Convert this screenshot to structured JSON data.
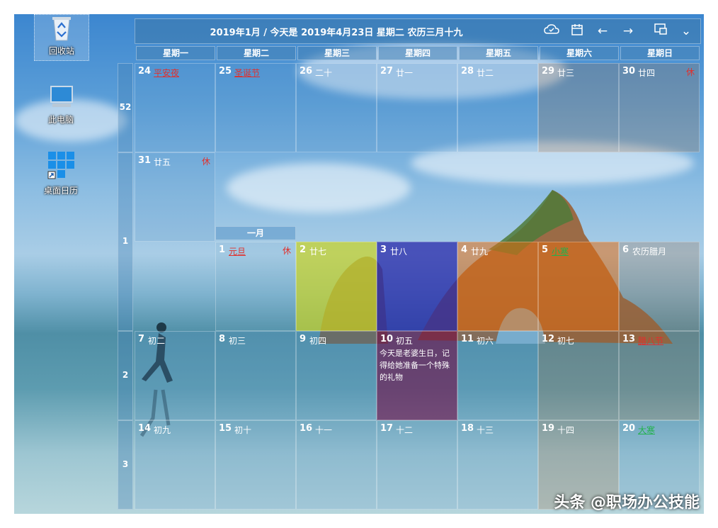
{
  "desktop_icons": [
    {
      "label": "回收站",
      "icon": "recycle-bin-icon"
    },
    {
      "label": "此电脑",
      "icon": "computer-icon"
    },
    {
      "label": "桌面日历",
      "icon": "desktop-calendar-shortcut-icon"
    }
  ],
  "header": {
    "title": "2019年1月 / 今天是 2019年4月23日 星期二 农历三月十九",
    "buttons": [
      "cloud-sync-icon",
      "calendar-icon",
      "arrow-left-icon",
      "arrow-right-icon",
      "window-mode-icon",
      "chevron-down-icon"
    ]
  },
  "weekdays": [
    "星期一",
    "星期二",
    "星期三",
    "星期四",
    "星期五",
    "星期六",
    "星期日"
  ],
  "week_numbers": [
    "52",
    "1",
    "2",
    "3"
  ],
  "month_label": "一月",
  "days": [
    {
      "d": "24",
      "l": "平安夜",
      "s": "red"
    },
    {
      "d": "25",
      "l": "圣诞节",
      "s": "red"
    },
    {
      "d": "26",
      "l": "二十"
    },
    {
      "d": "27",
      "l": "廿一"
    },
    {
      "d": "28",
      "l": "廿二"
    },
    {
      "d": "29",
      "l": "廿三"
    },
    {
      "d": "30",
      "l": "廿四",
      "rest": "休"
    },
    {
      "d": "31",
      "l": "廿五",
      "rest": "休"
    },
    {
      "d": "1",
      "l": "元旦",
      "s": "red",
      "rest": "休"
    },
    {
      "d": "2",
      "l": "廿七"
    },
    {
      "d": "3",
      "l": "廿八"
    },
    {
      "d": "4",
      "l": "廿九"
    },
    {
      "d": "5",
      "l": "小寒",
      "s": "green"
    },
    {
      "d": "6",
      "l": "农历腊月"
    },
    {
      "d": "7",
      "l": "初二"
    },
    {
      "d": "8",
      "l": "初三"
    },
    {
      "d": "9",
      "l": "初四"
    },
    {
      "d": "10",
      "l": "初五",
      "note": "今天是老婆生日，记得给她准备一个特殊的礼物"
    },
    {
      "d": "11",
      "l": "初六"
    },
    {
      "d": "12",
      "l": "初七"
    },
    {
      "d": "13",
      "l": "腊八节",
      "s": "red"
    },
    {
      "d": "14",
      "l": "初九"
    },
    {
      "d": "15",
      "l": "初十"
    },
    {
      "d": "16",
      "l": "十一"
    },
    {
      "d": "17",
      "l": "十二"
    },
    {
      "d": "18",
      "l": "十三"
    },
    {
      "d": "19",
      "l": "十四"
    },
    {
      "d": "20",
      "l": "大寒",
      "s": "green"
    }
  ],
  "watermark": "头条 @职场办公技能"
}
